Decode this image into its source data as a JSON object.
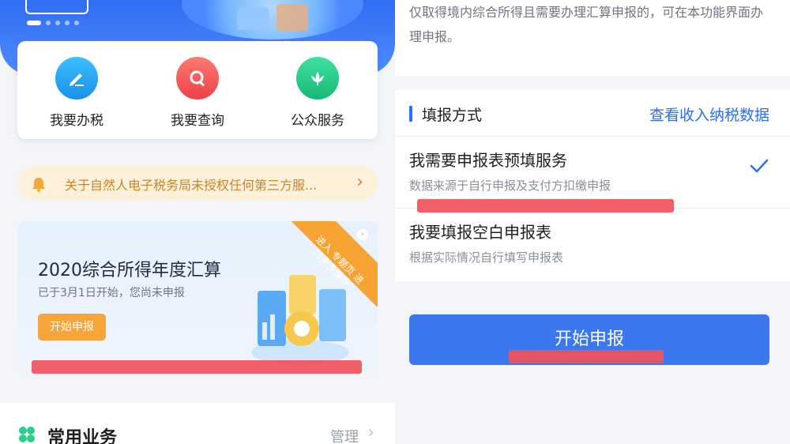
{
  "left": {
    "banner": {
      "button_label": "",
      "slide_count": 5,
      "active_slide": 1
    },
    "quick_actions": [
      {
        "label": "我要办税",
        "icon": "pencil-icon",
        "color": "#1aa3f2"
      },
      {
        "label": "我要查询",
        "icon": "magnifier-icon",
        "color": "#f2585a"
      },
      {
        "label": "公众服务",
        "icon": "lotus-icon",
        "color": "#2ccf8a"
      }
    ],
    "notice": {
      "icon": "bell-icon",
      "text": "关于自然人电子税务局未授权任何第三方服..."
    },
    "promo": {
      "title": "2020综合所得年度汇算",
      "subtitle": "已于3月1日开始，您尚未申报",
      "button_label": "开始申报",
      "ribbon_text": "进入 专题页 进行更多操作"
    },
    "common": {
      "icon": "four-leaf-icon",
      "title": "常用业务",
      "manage_label": "管理"
    }
  },
  "right": {
    "intro_text": "仅取得境内综合所得且需要办理汇算申报的，可在本功能界面办理申报。",
    "section": {
      "title": "填报方式",
      "link": "查看收入纳税数据"
    },
    "options": [
      {
        "title": "我需要申报表预填服务",
        "subtitle": "数据来源于自行申报及支付方扣缴申报",
        "selected": true
      },
      {
        "title": "我要填报空白申报表",
        "subtitle": "根据实际情况自行填写申报表",
        "selected": false
      }
    ],
    "start_button": "开始申报"
  },
  "colors": {
    "primary": "#2f6df2",
    "button": "#3b78f0",
    "orange": "#f7a53a",
    "redaction": "#f0535b",
    "notice_bg": "#fdf1d9"
  }
}
